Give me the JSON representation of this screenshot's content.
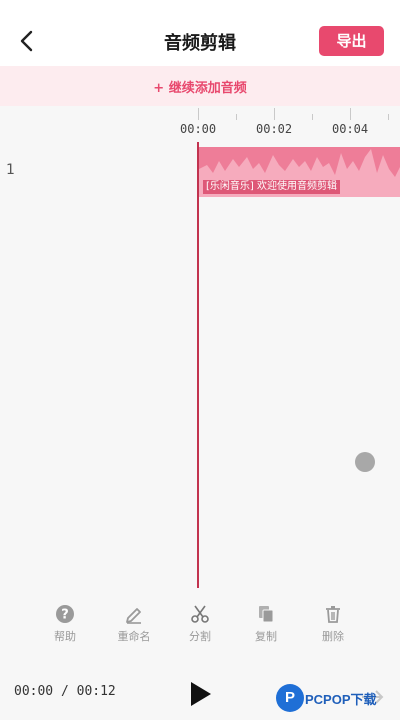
{
  "header": {
    "title": "音频剪辑",
    "export_label": "导出"
  },
  "add_bar": {
    "label": "+ 继续添加音频"
  },
  "ruler": {
    "ticks": [
      "00:00",
      "00:02",
      "00:04"
    ]
  },
  "track": {
    "number": "1",
    "clip_label": "[乐闲音乐] 欢迎使用音频剪辑"
  },
  "toolbar": {
    "items": [
      {
        "label": "帮助",
        "icon": "help-icon"
      },
      {
        "label": "重命名",
        "icon": "edit-icon"
      },
      {
        "label": "分割",
        "icon": "scissors-icon"
      },
      {
        "label": "复制",
        "icon": "copy-icon"
      },
      {
        "label": "删除",
        "icon": "trash-icon"
      }
    ]
  },
  "player": {
    "time": "00:00 / 00:12"
  },
  "watermark": {
    "logo_letter": "P",
    "text": "PCPOP下载"
  },
  "colors": {
    "accent": "#e8496e",
    "clip": "#ee7d98",
    "add_bar_bg": "#fdecef",
    "playhead": "#c2334f"
  }
}
